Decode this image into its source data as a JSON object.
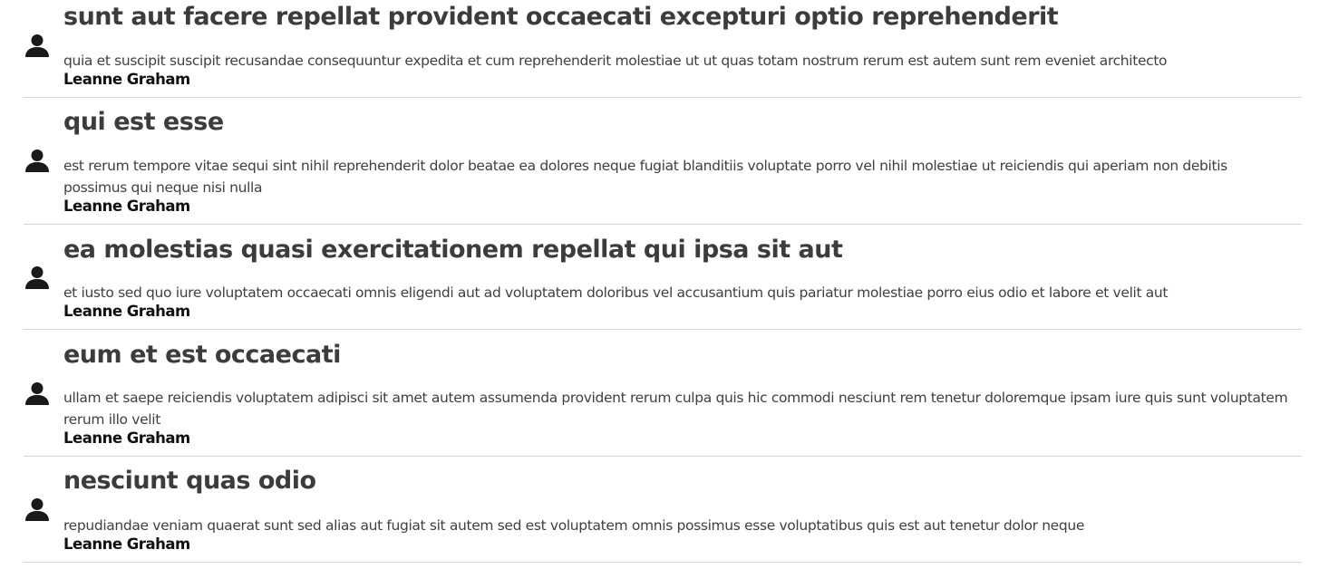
{
  "icons": {
    "avatar": "user-icon"
  },
  "colors": {
    "title": "#3c3c3c",
    "body": "#404040",
    "author": "#111111",
    "divider": "#d6d6d6",
    "icon": "#1a1a1a"
  },
  "posts": [
    {
      "title": "sunt aut facere repellat provident occaecati excepturi optio reprehenderit",
      "body": "quia et suscipit suscipit recusandae consequuntur expedita et cum reprehenderit molestiae ut ut quas totam nostrum rerum est autem sunt rem eveniet architecto",
      "author": "Leanne Graham"
    },
    {
      "title": "qui est esse",
      "body": "est rerum tempore vitae sequi sint nihil reprehenderit dolor beatae ea dolores neque fugiat blanditiis voluptate porro vel nihil molestiae ut reiciendis qui aperiam non debitis possimus qui neque nisi nulla",
      "author": "Leanne Graham"
    },
    {
      "title": "ea molestias quasi exercitationem repellat qui ipsa sit aut",
      "body": "et iusto sed quo iure voluptatem occaecati omnis eligendi aut ad voluptatem doloribus vel accusantium quis pariatur molestiae porro eius odio et labore et velit aut",
      "author": "Leanne Graham"
    },
    {
      "title": "eum et est occaecati",
      "body": "ullam et saepe reiciendis voluptatem adipisci sit amet autem assumenda provident rerum culpa quis hic commodi nesciunt rem tenetur doloremque ipsam iure quis sunt voluptatem rerum illo velit",
      "author": "Leanne Graham"
    },
    {
      "title": "nesciunt quas odio",
      "body": "repudiandae veniam quaerat sunt sed alias aut fugiat sit autem sed est voluptatem omnis possimus esse voluptatibus quis est aut tenetur dolor neque",
      "author": "Leanne Graham"
    }
  ]
}
